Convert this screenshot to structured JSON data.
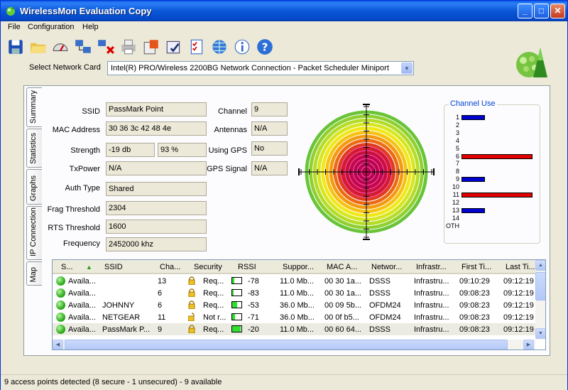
{
  "window": {
    "title": "WirelessMon Evaluation Copy"
  },
  "menu": [
    "File",
    "Configuration",
    "Help"
  ],
  "toolbar_icons": [
    "save-icon",
    "open-folder-icon",
    "gauge-icon",
    "network-icon",
    "disconnect-icon",
    "printer-icon",
    "export-icon",
    "config-icon",
    "checklist-icon",
    "globe-icon",
    "info-icon",
    "help-icon"
  ],
  "network_card": {
    "label": "Select Network Card",
    "value": "Intel(R) PRO/Wireless 2200BG Network Connection - Packet Scheduler Miniport"
  },
  "tabs": [
    "Summary",
    "Statistics",
    "Graphs",
    "IP Connection",
    "Map"
  ],
  "summary": {
    "ssid_label": "SSID",
    "ssid": "PassMark Point",
    "mac_label": "MAC Address",
    "mac": "30 36 3c 42 48 4e",
    "strength_label": "Strength",
    "strength_db": "-19 db",
    "strength_pct": "93 %",
    "txpower_label": "TxPower",
    "txpower": "N/A",
    "auth_label": "Auth Type",
    "auth": "Shared",
    "frag_label": "Frag Threshold",
    "frag": "2304",
    "rts_label": "RTS Threshold",
    "rts": "1600",
    "freq_label": "Frequency",
    "freq": "2452000 khz",
    "channel_label": "Channel",
    "channel": "9",
    "antennas_label": "Antennas",
    "antennas": "N/A",
    "gps_label": "Using GPS",
    "gps": "No",
    "gps_signal_label": "GPS Signal",
    "gps_signal": "N/A"
  },
  "channel_use": {
    "title": "Channel Use",
    "channels": [
      {
        "label": "1",
        "value": 0.33,
        "color": "#0000d0"
      },
      {
        "label": "2",
        "value": 0,
        "color": "#0000d0"
      },
      {
        "label": "3",
        "value": 0,
        "color": "#0000d0"
      },
      {
        "label": "4",
        "value": 0,
        "color": "#0000d0"
      },
      {
        "label": "5",
        "value": 0,
        "color": "#0000d0"
      },
      {
        "label": "6",
        "value": 1.0,
        "color": "#e00000"
      },
      {
        "label": "7",
        "value": 0,
        "color": "#0000d0"
      },
      {
        "label": "8",
        "value": 0,
        "color": "#0000d0"
      },
      {
        "label": "9",
        "value": 0.33,
        "color": "#0000d0"
      },
      {
        "label": "10",
        "value": 0,
        "color": "#0000d0"
      },
      {
        "label": "11",
        "value": 1.0,
        "color": "#e00000"
      },
      {
        "label": "12",
        "value": 0,
        "color": "#0000d0"
      },
      {
        "label": "13",
        "value": 0.33,
        "color": "#0000d0"
      },
      {
        "label": "14",
        "value": 0,
        "color": "#0000d0"
      },
      {
        "label": "OTH",
        "value": 0,
        "color": "#0000d0"
      }
    ]
  },
  "list": {
    "columns": [
      "S...",
      "SSID",
      "Cha...",
      "Security",
      "RSSI",
      "Suppor...",
      "MAC A...",
      "Networ...",
      "Infrastr...",
      "First Ti...",
      "Last Ti..."
    ],
    "rows": [
      {
        "status": "Availa...",
        "ssid": "",
        "channel": "13",
        "security": "Req...",
        "locked": true,
        "rssi": "-78",
        "signal": 0.2,
        "supported": "11.0 Mb...",
        "mac": "00 30 1a...",
        "network": "DSSS",
        "infra": "Infrastru...",
        "first": "09:10:29",
        "last": "09:12:19"
      },
      {
        "status": "Availa...",
        "ssid": "",
        "channel": "6",
        "security": "Req...",
        "locked": true,
        "rssi": "-83",
        "signal": 0.15,
        "supported": "11.0 Mb...",
        "mac": "00 30 1a...",
        "network": "DSSS",
        "infra": "Infrastru...",
        "first": "09:08:23",
        "last": "09:12:19"
      },
      {
        "status": "Availa...",
        "ssid": "JOHNNY",
        "channel": "6",
        "security": "Req...",
        "locked": true,
        "rssi": "-53",
        "signal": 0.55,
        "supported": "36.0 Mb...",
        "mac": "00 09 5b...",
        "network": "OFDM24",
        "infra": "Infrastru...",
        "first": "09:08:23",
        "last": "09:12:19"
      },
      {
        "status": "Availa...",
        "ssid": "NETGEAR",
        "channel": "11",
        "security": "Not r...",
        "locked": false,
        "rssi": "-71",
        "signal": 0.3,
        "supported": "36.0 Mb...",
        "mac": "00 0f b5...",
        "network": "OFDM24",
        "infra": "Infrastru...",
        "first": "09:08:23",
        "last": "09:12:19"
      },
      {
        "status": "Availa...",
        "ssid": "PassMark P...",
        "channel": "9",
        "security": "Req...",
        "locked": true,
        "rssi": "-20",
        "signal": 0.95,
        "supported": "11.0 Mb...",
        "mac": "00 60 64...",
        "network": "DSSS",
        "infra": "Infrastru...",
        "first": "09:08:23",
        "last": "09:12:19",
        "selected": true
      }
    ]
  },
  "status_bar": "9 access points detected (8 secure - 1 unsecured) - 9 available"
}
